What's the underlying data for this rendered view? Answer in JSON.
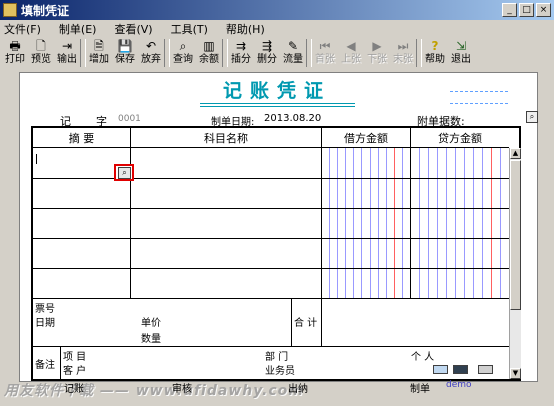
{
  "window": {
    "title": "填制凭证",
    "minimize": "_",
    "maximize": "□",
    "close": "×"
  },
  "menu": [
    "文件(F)",
    "制单(E)",
    "查看(V)",
    "工具(T)",
    "帮助(H)"
  ],
  "toolbar": {
    "print": "打印",
    "preview": "预览",
    "export": "输出",
    "add": "增加",
    "save": "保存",
    "discard": "放弃",
    "query": "查询",
    "balance": "余额",
    "insert_row": "插分",
    "delete_row": "删分",
    "flow": "流量",
    "first": "首张",
    "prev": "上张",
    "next": "下张",
    "last": "末张",
    "help": "帮助",
    "exit": "退出"
  },
  "voucher": {
    "title": "记账凭证",
    "ji": "记",
    "zi": "字",
    "number": "0001",
    "date_label": "制单日期:",
    "date": "2013.08.20",
    "attachments_label": "附单据数:",
    "columns": {
      "summary": "摘 要",
      "account": "科目名称",
      "debit": "借方金额",
      "credit": "贷方金额"
    },
    "bottom": {
      "ticket_no": "票号",
      "date": "日期",
      "unit_price": "单价",
      "quantity": "数量",
      "total": "合 计",
      "remark": "备注",
      "project": "项  目",
      "customer": "客  户",
      "department": "部  门",
      "salesperson": "业务员",
      "person": "个  人"
    }
  },
  "footer": {
    "watermark": "用友软件下载 —— www.ufidawhy.com",
    "bookkeeping": "记账",
    "audit": "审核",
    "cashier": "出纳",
    "preparer_label": "制单",
    "preparer": "demo"
  }
}
